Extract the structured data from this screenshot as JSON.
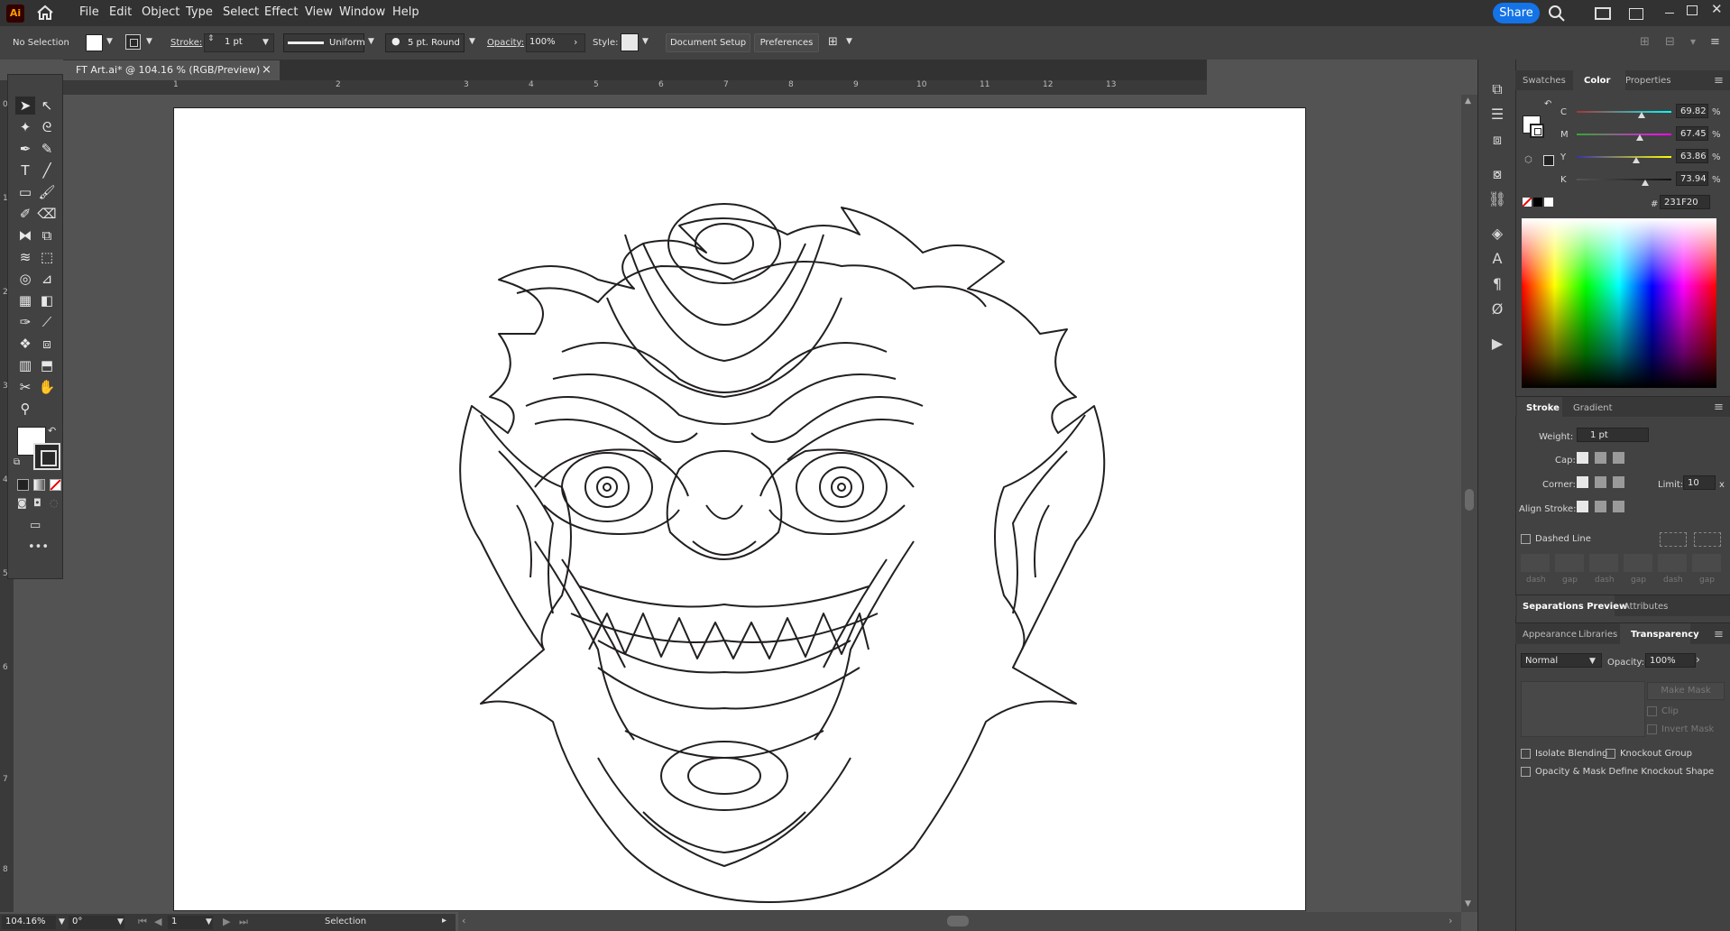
{
  "app": {
    "logo_text": "Ai"
  },
  "menu": [
    "File",
    "Edit",
    "Object",
    "Type",
    "Select",
    "Effect",
    "View",
    "Window",
    "Help"
  ],
  "share_label": "Share",
  "control": {
    "selection": "No Selection",
    "stroke_label": "Stroke:",
    "stroke_weight": "1 pt",
    "profile": "Uniform",
    "brush": "5 pt. Round",
    "opacity_label": "Opacity:",
    "opacity": "100%",
    "style_label": "Style:",
    "doc_setup": "Document Setup",
    "preferences": "Preferences"
  },
  "document_tab": {
    "title": "FT Art.ai* @ 104.16 % (RGB/Preview)",
    "close": "×"
  },
  "ruler_top": [
    "1",
    "2",
    "3",
    "4",
    "5",
    "6",
    "7",
    "8",
    "9",
    "10",
    "11",
    "12",
    "13"
  ],
  "ruler_left": [
    "0",
    "1",
    "2",
    "3",
    "4",
    "5",
    "6",
    "7",
    "8"
  ],
  "status": {
    "zoom": "104.16%",
    "rotation": "0°",
    "artboard": "1",
    "tool": "Selection"
  },
  "panel_tabs_top": {
    "swatches": "Swatches",
    "color": "Color",
    "properties": "Properties"
  },
  "color": {
    "channels": [
      {
        "label": "C",
        "value": "69.82",
        "pct": "%"
      },
      {
        "label": "M",
        "value": "67.45",
        "pct": "%"
      },
      {
        "label": "Y",
        "value": "63.86",
        "pct": "%"
      },
      {
        "label": "K",
        "value": "73.94",
        "pct": "%"
      }
    ],
    "hex_symbol": "#",
    "hex": "231F20"
  },
  "stroke_panel": {
    "tab_stroke": "Stroke",
    "tab_gradient": "Gradient",
    "weight_label": "Weight:",
    "weight": "1 pt",
    "cap_label": "Cap:",
    "corner_label": "Corner:",
    "limit_label": "Limit:",
    "limit": "10",
    "limit_x": "x",
    "align_label": "Align Stroke:",
    "dashed_label": "Dashed Line",
    "dash_labels": [
      "dash",
      "gap",
      "dash",
      "gap",
      "dash",
      "gap"
    ]
  },
  "sep_tabs": {
    "separations": "Separations Preview",
    "attributes": "Attributes"
  },
  "transparency": {
    "tab_appearance": "Appearance",
    "tab_libraries": "Libraries",
    "tab_transparency": "Transparency",
    "blend_mode": "Normal",
    "opacity_label": "Opacity:",
    "opacity": "100%",
    "make_mask": "Make Mask",
    "clip": "Clip",
    "invert_mask": "Invert Mask",
    "isolate": "Isolate Blending",
    "knockout": "Knockout Group",
    "opacity_mask": "Opacity & Mask Define Knockout Shape"
  },
  "colors": {
    "accent": "#1473e6",
    "fill": "#ffffff",
    "stroke": "#231f20"
  }
}
